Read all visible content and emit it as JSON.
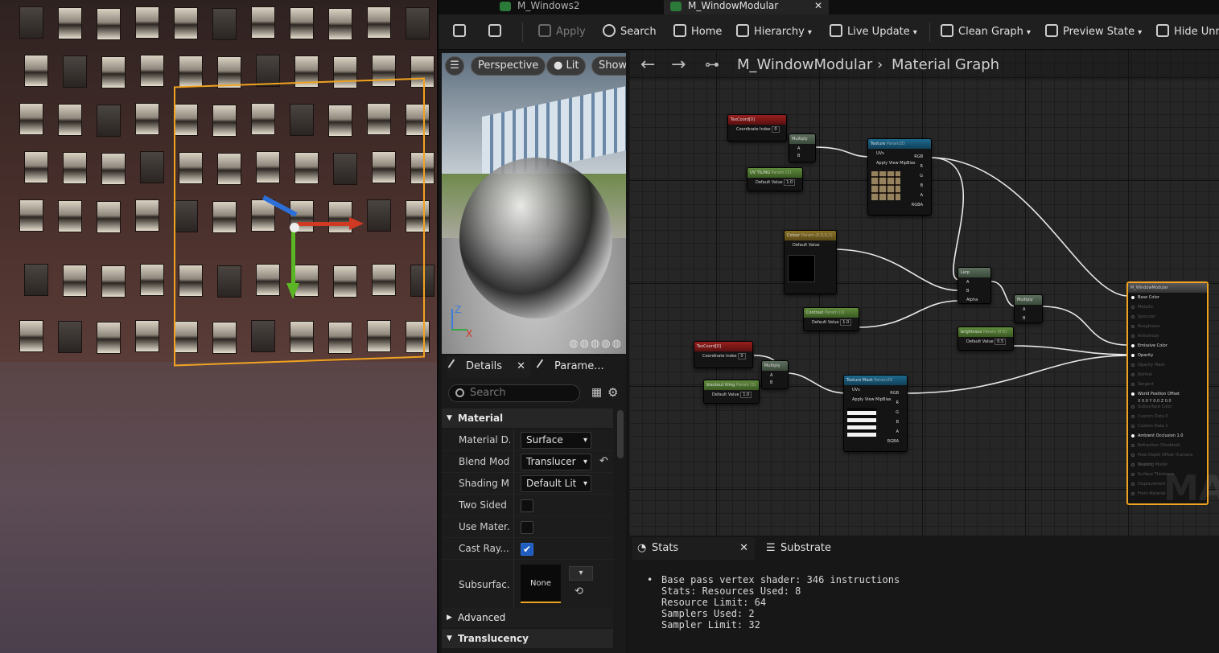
{
  "tabs": [
    {
      "label": "M_Windows2",
      "active": false
    },
    {
      "label": "M_WindowModular",
      "active": true
    }
  ],
  "toolbar": {
    "apply": "Apply",
    "search": "Search",
    "home": "Home",
    "hierarchy": "Hierarchy",
    "live_update": "Live Update",
    "clean_graph": "Clean Graph",
    "preview_state": "Preview State",
    "hide_unrelated": "Hide Unre"
  },
  "preview": {
    "perspective": "Perspective",
    "lit": "Lit",
    "show": "Show",
    "axis_z": "Z",
    "axis_x": "X"
  },
  "details": {
    "tab_details": "Details",
    "tab_parameters": "Parame...",
    "search_placeholder": "Search",
    "category_material": "Material",
    "rows": [
      {
        "label": "Material D...",
        "type": "combo",
        "value": "Surface"
      },
      {
        "label": "Blend Mode",
        "type": "combo",
        "value": "Translucer"
      },
      {
        "label": "Shading M...",
        "type": "combo",
        "value": "Default Lit"
      },
      {
        "label": "Two Sided",
        "type": "check",
        "value": false
      },
      {
        "label": "Use Mater...",
        "type": "check",
        "value": false
      },
      {
        "label": "Cast Ray...",
        "type": "check",
        "value": true
      },
      {
        "label": "Subsurfac...",
        "type": "asset",
        "value": "None"
      }
    ],
    "category_advanced": "Advanced",
    "category_translucency": "Translucency"
  },
  "graph": {
    "breadcrumb_root": "M_WindowModular",
    "breadcrumb_current": "Material Graph",
    "watermark": "MAT",
    "nodes": {
      "texcoord1": {
        "title": "TexCoord[0]",
        "row": "Coordinate Index",
        "value": "0"
      },
      "multiply1": {
        "title": "Multiply",
        "a": "A",
        "b": "B"
      },
      "uv_tiling": {
        "title": "UV TILING",
        "sub": "Param (1)",
        "row": "Default Value",
        "value": "1.0"
      },
      "texture": {
        "title": "Texture",
        "sub": "Param2D",
        "uvs": "UVs",
        "mip": "Apply View MipBias",
        "rgb": "RGB",
        "r": "R",
        "g": "G",
        "b": "B",
        "a": "A",
        "rgba": "RGBA"
      },
      "colour": {
        "title": "Colour",
        "sub": "Param (0,0,0,1)",
        "row": "Default Value"
      },
      "lerp": {
        "title": "Lerp",
        "a": "A",
        "b": "B",
        "alpha": "Alpha"
      },
      "contrast": {
        "title": "Contrast",
        "sub": "Param (1)",
        "row": "Default Value",
        "value": "1.0"
      },
      "multiply2": {
        "title": "Multiply",
        "a": "A",
        "b": "B"
      },
      "brightness": {
        "title": "brightness",
        "sub": "Param (0.5)",
        "row": "Default Value",
        "value": "0.5"
      },
      "texcoord2": {
        "title": "TexCoord[0]",
        "row": "Coordinate Index",
        "value": "0"
      },
      "multiply3": {
        "title": "Multiply",
        "a": "A",
        "b": "B"
      },
      "blackout_tiling": {
        "title": "blackout tiling",
        "sub": "Param (1)",
        "row": "Default Value",
        "value": "1.0"
      },
      "texture_mask": {
        "title": "Texture Mask",
        "sub": "Param2D",
        "uvs": "UVs",
        "mip": "Apply View MipBias",
        "rgb": "RGB",
        "r": "R",
        "g": "G",
        "b": "B",
        "a": "A",
        "rgba": "RGBA"
      }
    },
    "result": {
      "title": "M_WindowModular",
      "pins": [
        {
          "label": "Base Color",
          "on": true
        },
        {
          "label": "Metallic",
          "on": false
        },
        {
          "label": "Specular",
          "on": false
        },
        {
          "label": "Roughness",
          "on": false
        },
        {
          "label": "Anisotropy",
          "on": false
        },
        {
          "label": "Emissive Color",
          "on": true
        },
        {
          "label": "Opacity",
          "on": true
        },
        {
          "label": "Opacity Mask",
          "on": false
        },
        {
          "label": "Normal",
          "on": false
        },
        {
          "label": "Tangent",
          "on": false
        },
        {
          "label": "World Position Offset",
          "on": true
        },
        {
          "label": "Subsurface Color",
          "on": false
        },
        {
          "label": "Custom Data 0",
          "on": false
        },
        {
          "label": "Custom Data 1",
          "on": false
        },
        {
          "label": "Ambient Occlusion 1.0",
          "on": true
        },
        {
          "label": "Refraction (Disabled)",
          "on": false
        },
        {
          "label": "Pixel Depth Offset (Camera Vector)",
          "on": false
        },
        {
          "label": "Shading Model",
          "on": false
        },
        {
          "label": "Surface Thickness",
          "on": false
        },
        {
          "label": "Displacement",
          "on": false
        },
        {
          "label": "Front Material",
          "on": false
        }
      ],
      "wpo_values": "X 0.0  Y 0.0  Z 0.0"
    }
  },
  "stats": {
    "tab_stats": "Stats",
    "tab_substrate": "Substrate",
    "lines": [
      "Base pass vertex shader: 346 instructions",
      "Stats: Resources Used: 8",
      "Resource Limit: 64",
      "Samplers Used: 2",
      "Sampler Limit: 32"
    ]
  }
}
